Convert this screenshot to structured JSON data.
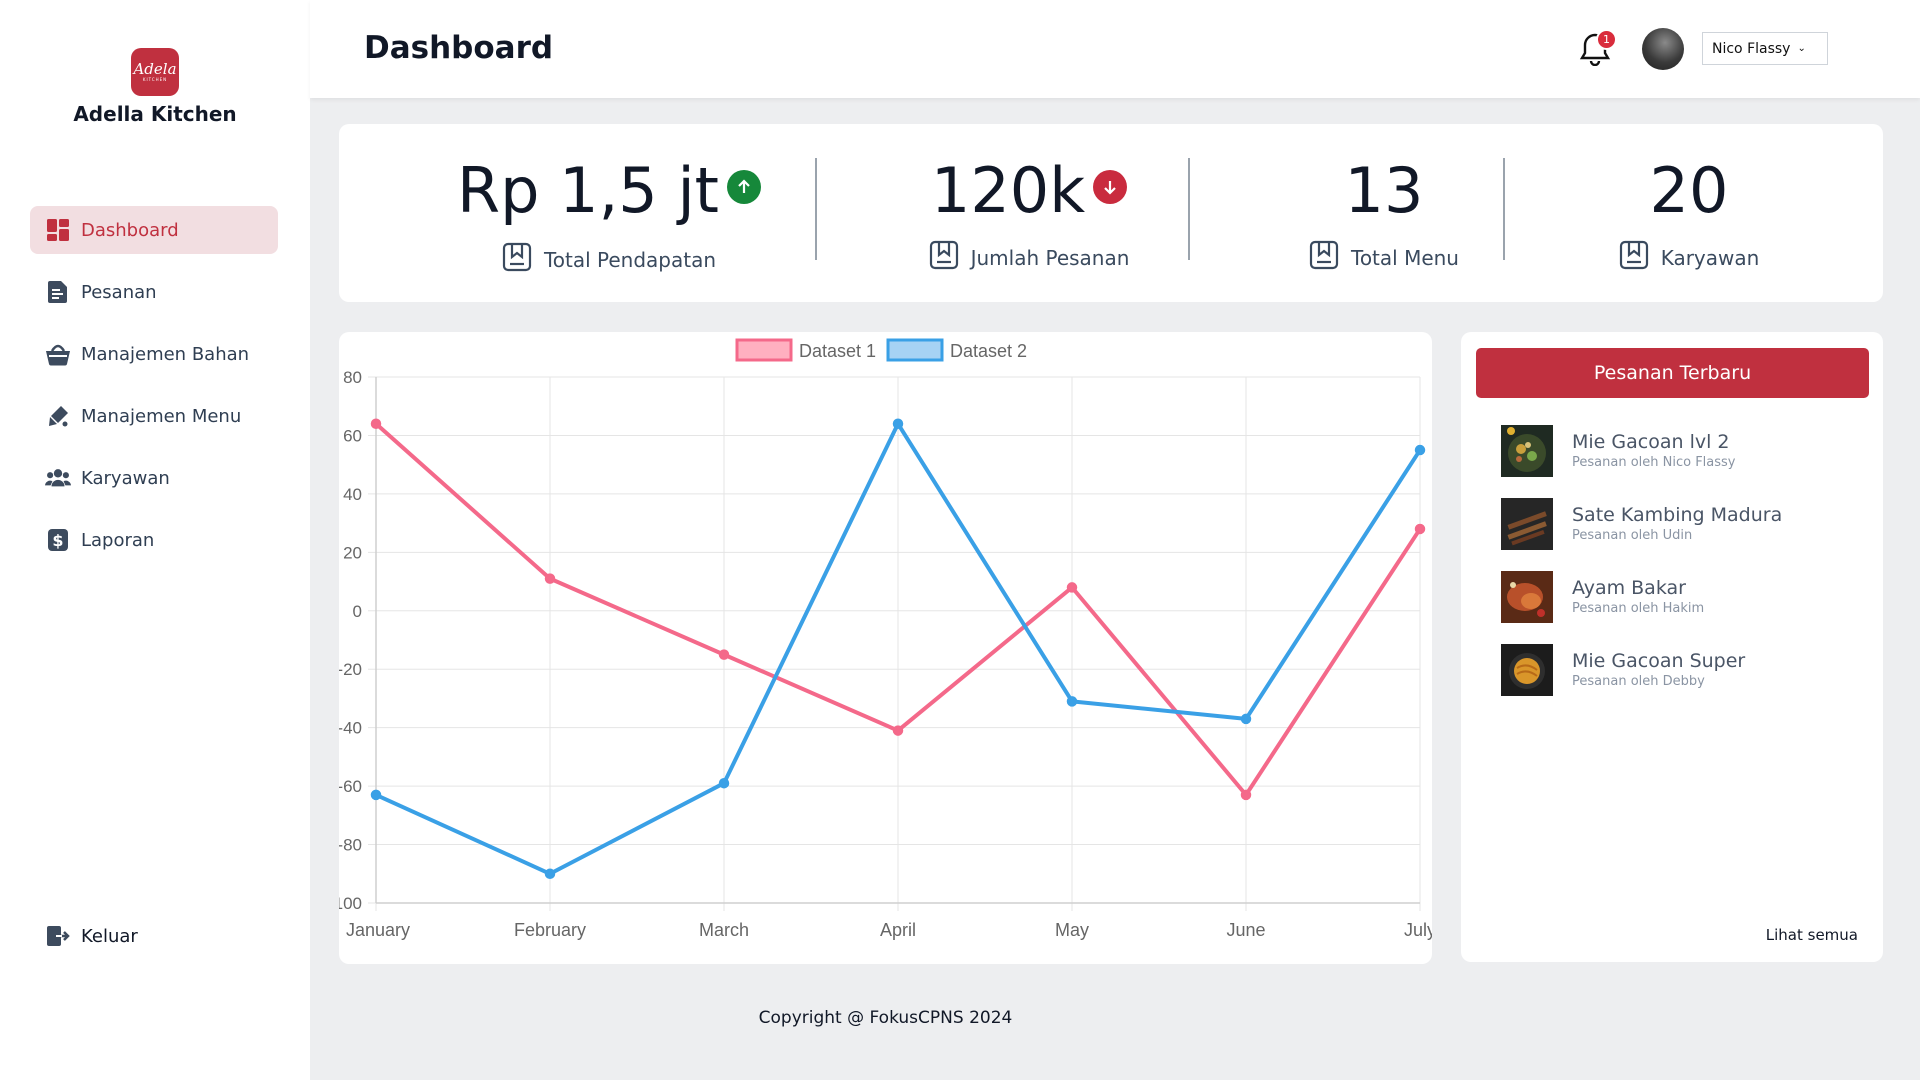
{
  "brand": {
    "name": "Adella Kitchen",
    "logo_text": "Adela",
    "logo_subtext": "KITCHEN"
  },
  "sidebar": {
    "items": [
      {
        "label": "Dashboard",
        "icon": "dashboard-grid-icon",
        "active": true
      },
      {
        "label": "Pesanan",
        "icon": "document-icon"
      },
      {
        "label": "Manajemen Bahan",
        "icon": "basket-icon"
      },
      {
        "label": "Manajemen Menu",
        "icon": "pen-icon"
      },
      {
        "label": "Karyawan",
        "icon": "users-icon"
      },
      {
        "label": "Laporan",
        "icon": "dollar-icon"
      }
    ],
    "logout_label": "Keluar"
  },
  "header": {
    "title": "Dashboard",
    "notification_count": "1",
    "user_name": "Nico Flassy"
  },
  "stats": [
    {
      "value": "Rp 1,5 jt",
      "label": "Total Pendapatan",
      "trend": "up"
    },
    {
      "value": "120k",
      "label": "Jumlah Pesanan",
      "trend": "down"
    },
    {
      "value": "13",
      "label": "Total Menu"
    },
    {
      "value": "20",
      "label": "Karyawan"
    }
  ],
  "colors": {
    "accent": "#c0303f",
    "trend_up": "#16883a",
    "trend_down": "#c92b3e",
    "dataset1": "#f4698a",
    "dataset2": "#3aa0e6"
  },
  "chart_data": {
    "type": "line",
    "categories": [
      "January",
      "February",
      "March",
      "April",
      "May",
      "June",
      "July"
    ],
    "y_tick_labels": [
      "80",
      "60",
      "40",
      "20",
      "0",
      "-20",
      "-40",
      "-60",
      "-80",
      "-100"
    ],
    "ylim": [
      -100,
      80
    ],
    "grid": true,
    "legend": "top-center",
    "series": [
      {
        "name": "Dataset 1",
        "values": [
          64,
          11,
          -15,
          -41,
          8,
          -63,
          28
        ]
      },
      {
        "name": "Dataset 2",
        "values": [
          -63,
          -90,
          -59,
          64,
          -31,
          -37,
          55
        ]
      }
    ]
  },
  "orders": {
    "title": "Pesanan Terbaru",
    "items": [
      {
        "name": "Mie Gacoan lvl 2",
        "by": "Pesanan oleh Nico Flassy"
      },
      {
        "name": "Sate Kambing Madura",
        "by": "Pesanan oleh Udin"
      },
      {
        "name": "Ayam Bakar",
        "by": "Pesanan oleh Hakim"
      },
      {
        "name": "Mie Gacoan Super",
        "by": "Pesanan oleh Debby"
      }
    ],
    "see_all": "Lihat semua"
  },
  "footer": {
    "copyright": "Copyright @ FokusCPNS 2024"
  }
}
